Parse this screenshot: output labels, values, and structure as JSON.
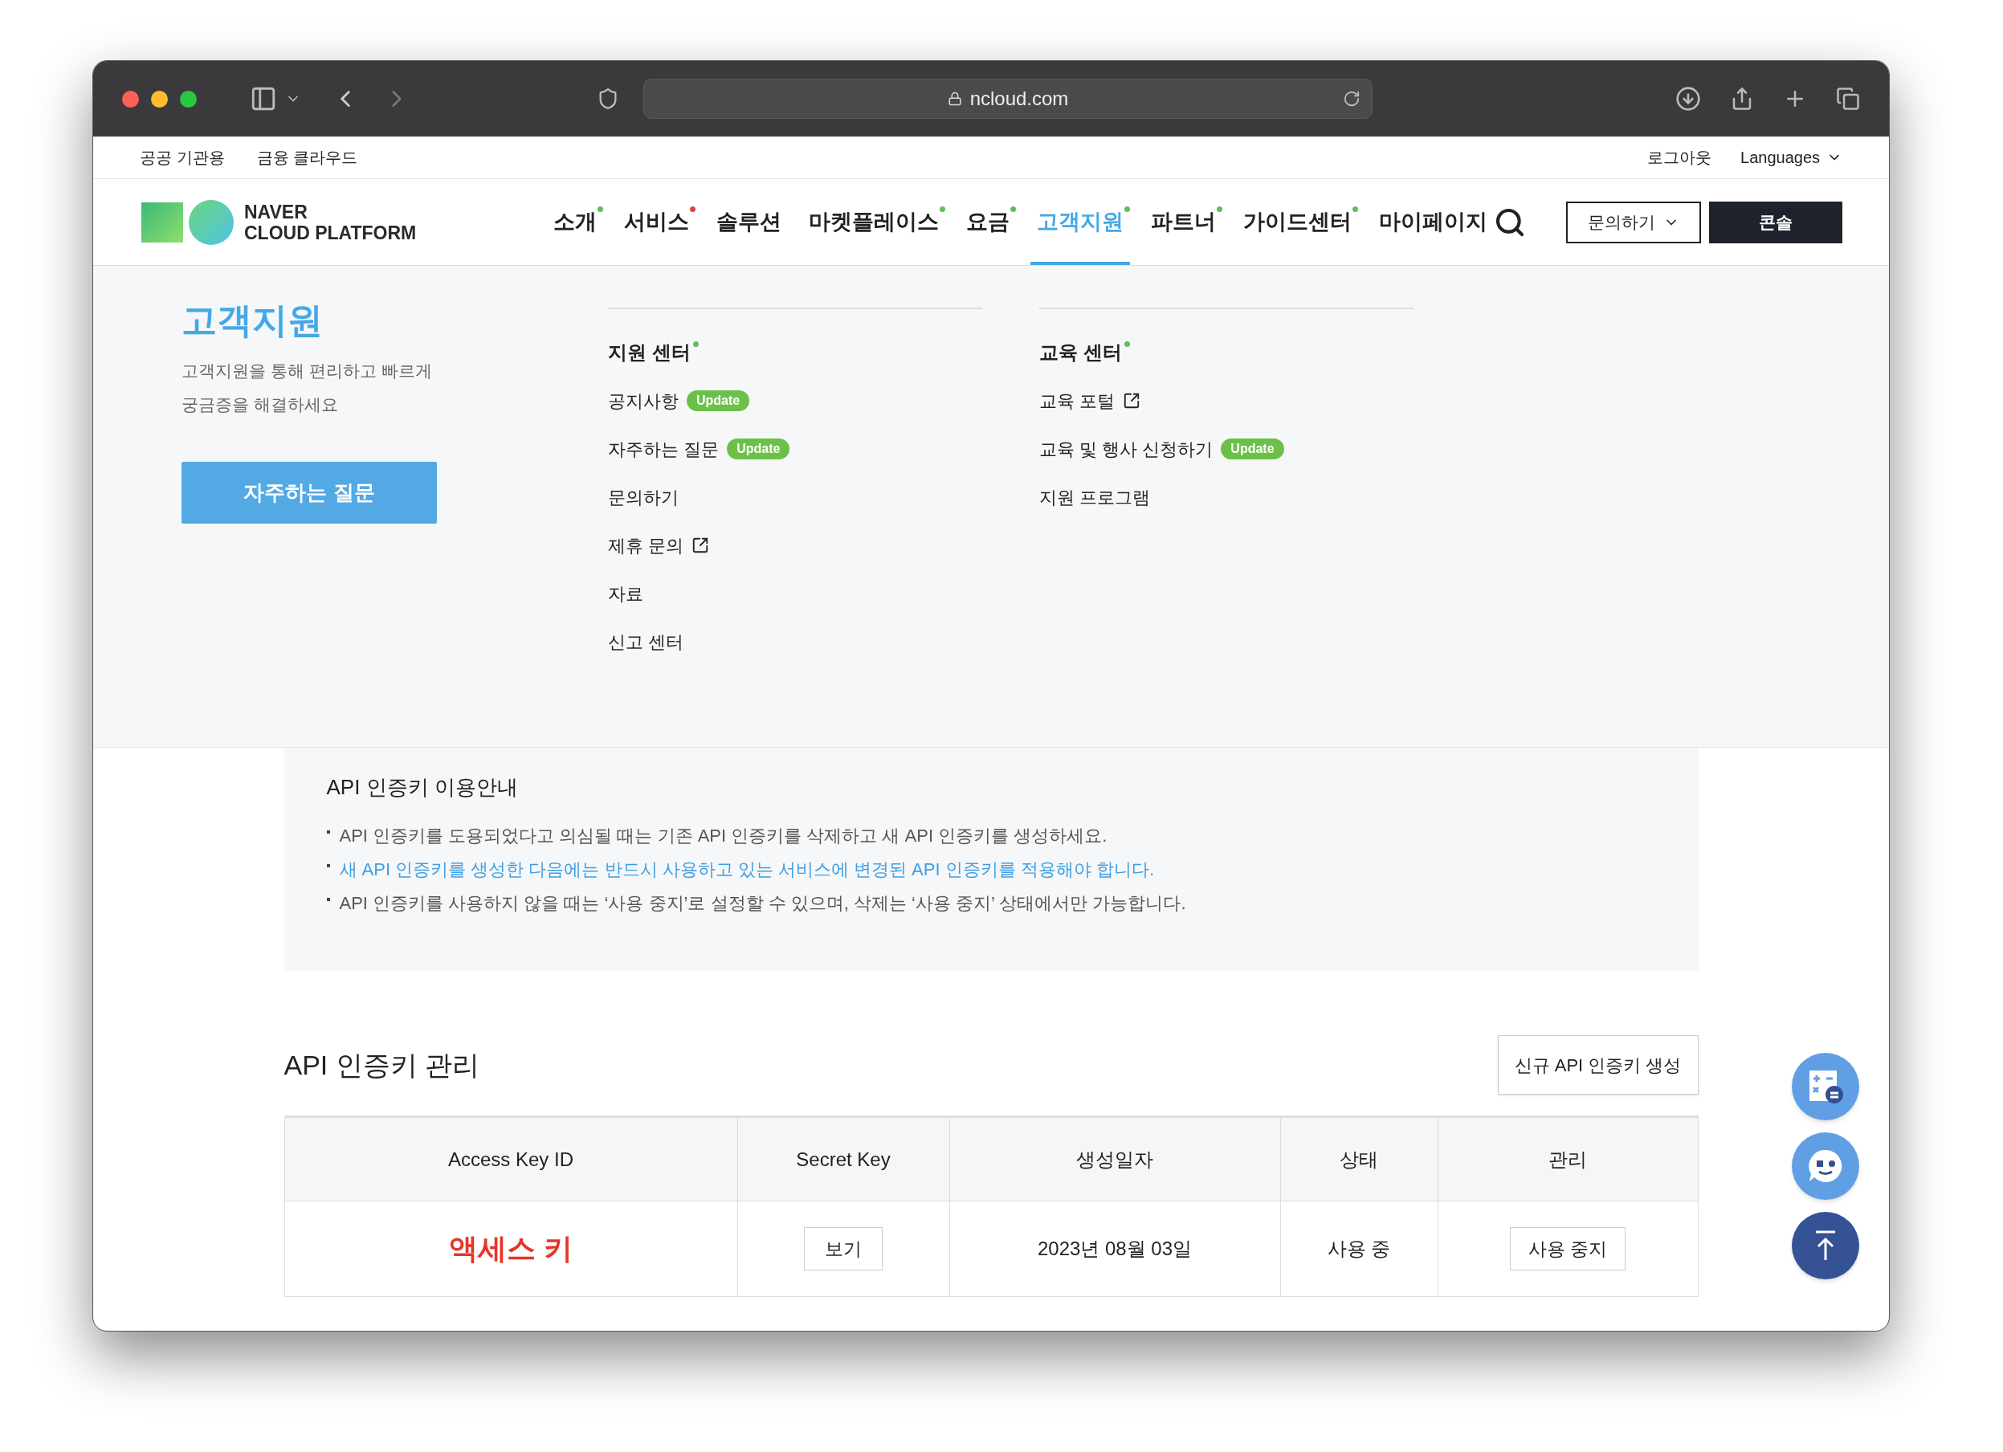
{
  "browser": {
    "url": "ncloud.com"
  },
  "top_links": [
    "공공 기관용",
    "금융 클라우드"
  ],
  "top_right": {
    "logout": "로그아웃",
    "languages": "Languages"
  },
  "logo": {
    "line1": "NAVER",
    "line2": "CLOUD PLATFORM"
  },
  "nav": [
    {
      "label": "소개",
      "selected": false,
      "color": "#5cc15a"
    },
    {
      "label": "서비스",
      "selected": false,
      "color": "#e5433a"
    },
    {
      "label": "솔루션",
      "selected": false
    },
    {
      "label": "마켓플레이스",
      "selected": false,
      "color": "#5cc15a"
    },
    {
      "label": "요금",
      "selected": false,
      "color": "#5cc15a"
    },
    {
      "label": "고객지원",
      "selected": true,
      "color": "#5cc15a"
    },
    {
      "label": "파트너",
      "selected": false,
      "color": "#5cc15a"
    },
    {
      "label": "가이드센터",
      "selected": false,
      "color": "#5cc15a"
    },
    {
      "label": "마이페이지",
      "selected": false
    }
  ],
  "header_buttons": {
    "inquiry": "문의하기",
    "console": "콘솔"
  },
  "mega_menu": {
    "title": "고객지원",
    "description": "고객지원을 통해 편리하고 빠르게\n궁금증을 해결하세요",
    "button": "자주하는 질문",
    "columns": [
      {
        "title": "지원 센터",
        "color": "#5cc15a",
        "items": [
          {
            "label": "공지사항",
            "badge": "Update",
            "external": false
          },
          {
            "label": "자주하는 질문",
            "badge": "Update",
            "external": false
          },
          {
            "label": "문의하기",
            "external": false
          },
          {
            "label": "제휴 문의",
            "external": true
          },
          {
            "label": "자료",
            "external": false
          },
          {
            "label": "신고 센터",
            "external": false
          }
        ]
      },
      {
        "title": "교육 센터",
        "color": "#5cc15a",
        "items": [
          {
            "label": "교육 포털",
            "external": true
          },
          {
            "label": "교육 및 행사 신청하기",
            "badge": "Update",
            "external": false
          },
          {
            "label": "지원 프로그램",
            "external": false
          }
        ]
      }
    ]
  },
  "info": {
    "title": "API 인증키 이용안내",
    "notes": [
      {
        "text": "API 인증키를 도용되었다고 의심될 때는 기존 API 인증키를 삭제하고 새 API 인증키를 생성하세요.",
        "highlight": false
      },
      {
        "text": "새 API 인증키를 생성한 다음에는 반드시 사용하고 있는 서비스에 변경된 API 인증키를 적용해야 합니다.",
        "highlight": true
      },
      {
        "text": "API 인증키를 사용하지 않을 때는 ‘사용 중지’로 설정할 수 있으며, 삭제는 ‘사용 중지’ 상태에서만 가능합니다.",
        "highlight": false
      }
    ]
  },
  "api_keys": {
    "title": "API 인증키 관리",
    "create_button": "신규 API 인증키 생성",
    "columns": [
      "Access Key ID",
      "Secret Key",
      "생성일자",
      "상태",
      "관리"
    ],
    "rows": [
      {
        "access_key": "액세스 키",
        "secret_button": "보기",
        "created": "2023년 08월 03일",
        "status": "사용 중",
        "action_button": "사용 중지"
      }
    ]
  }
}
